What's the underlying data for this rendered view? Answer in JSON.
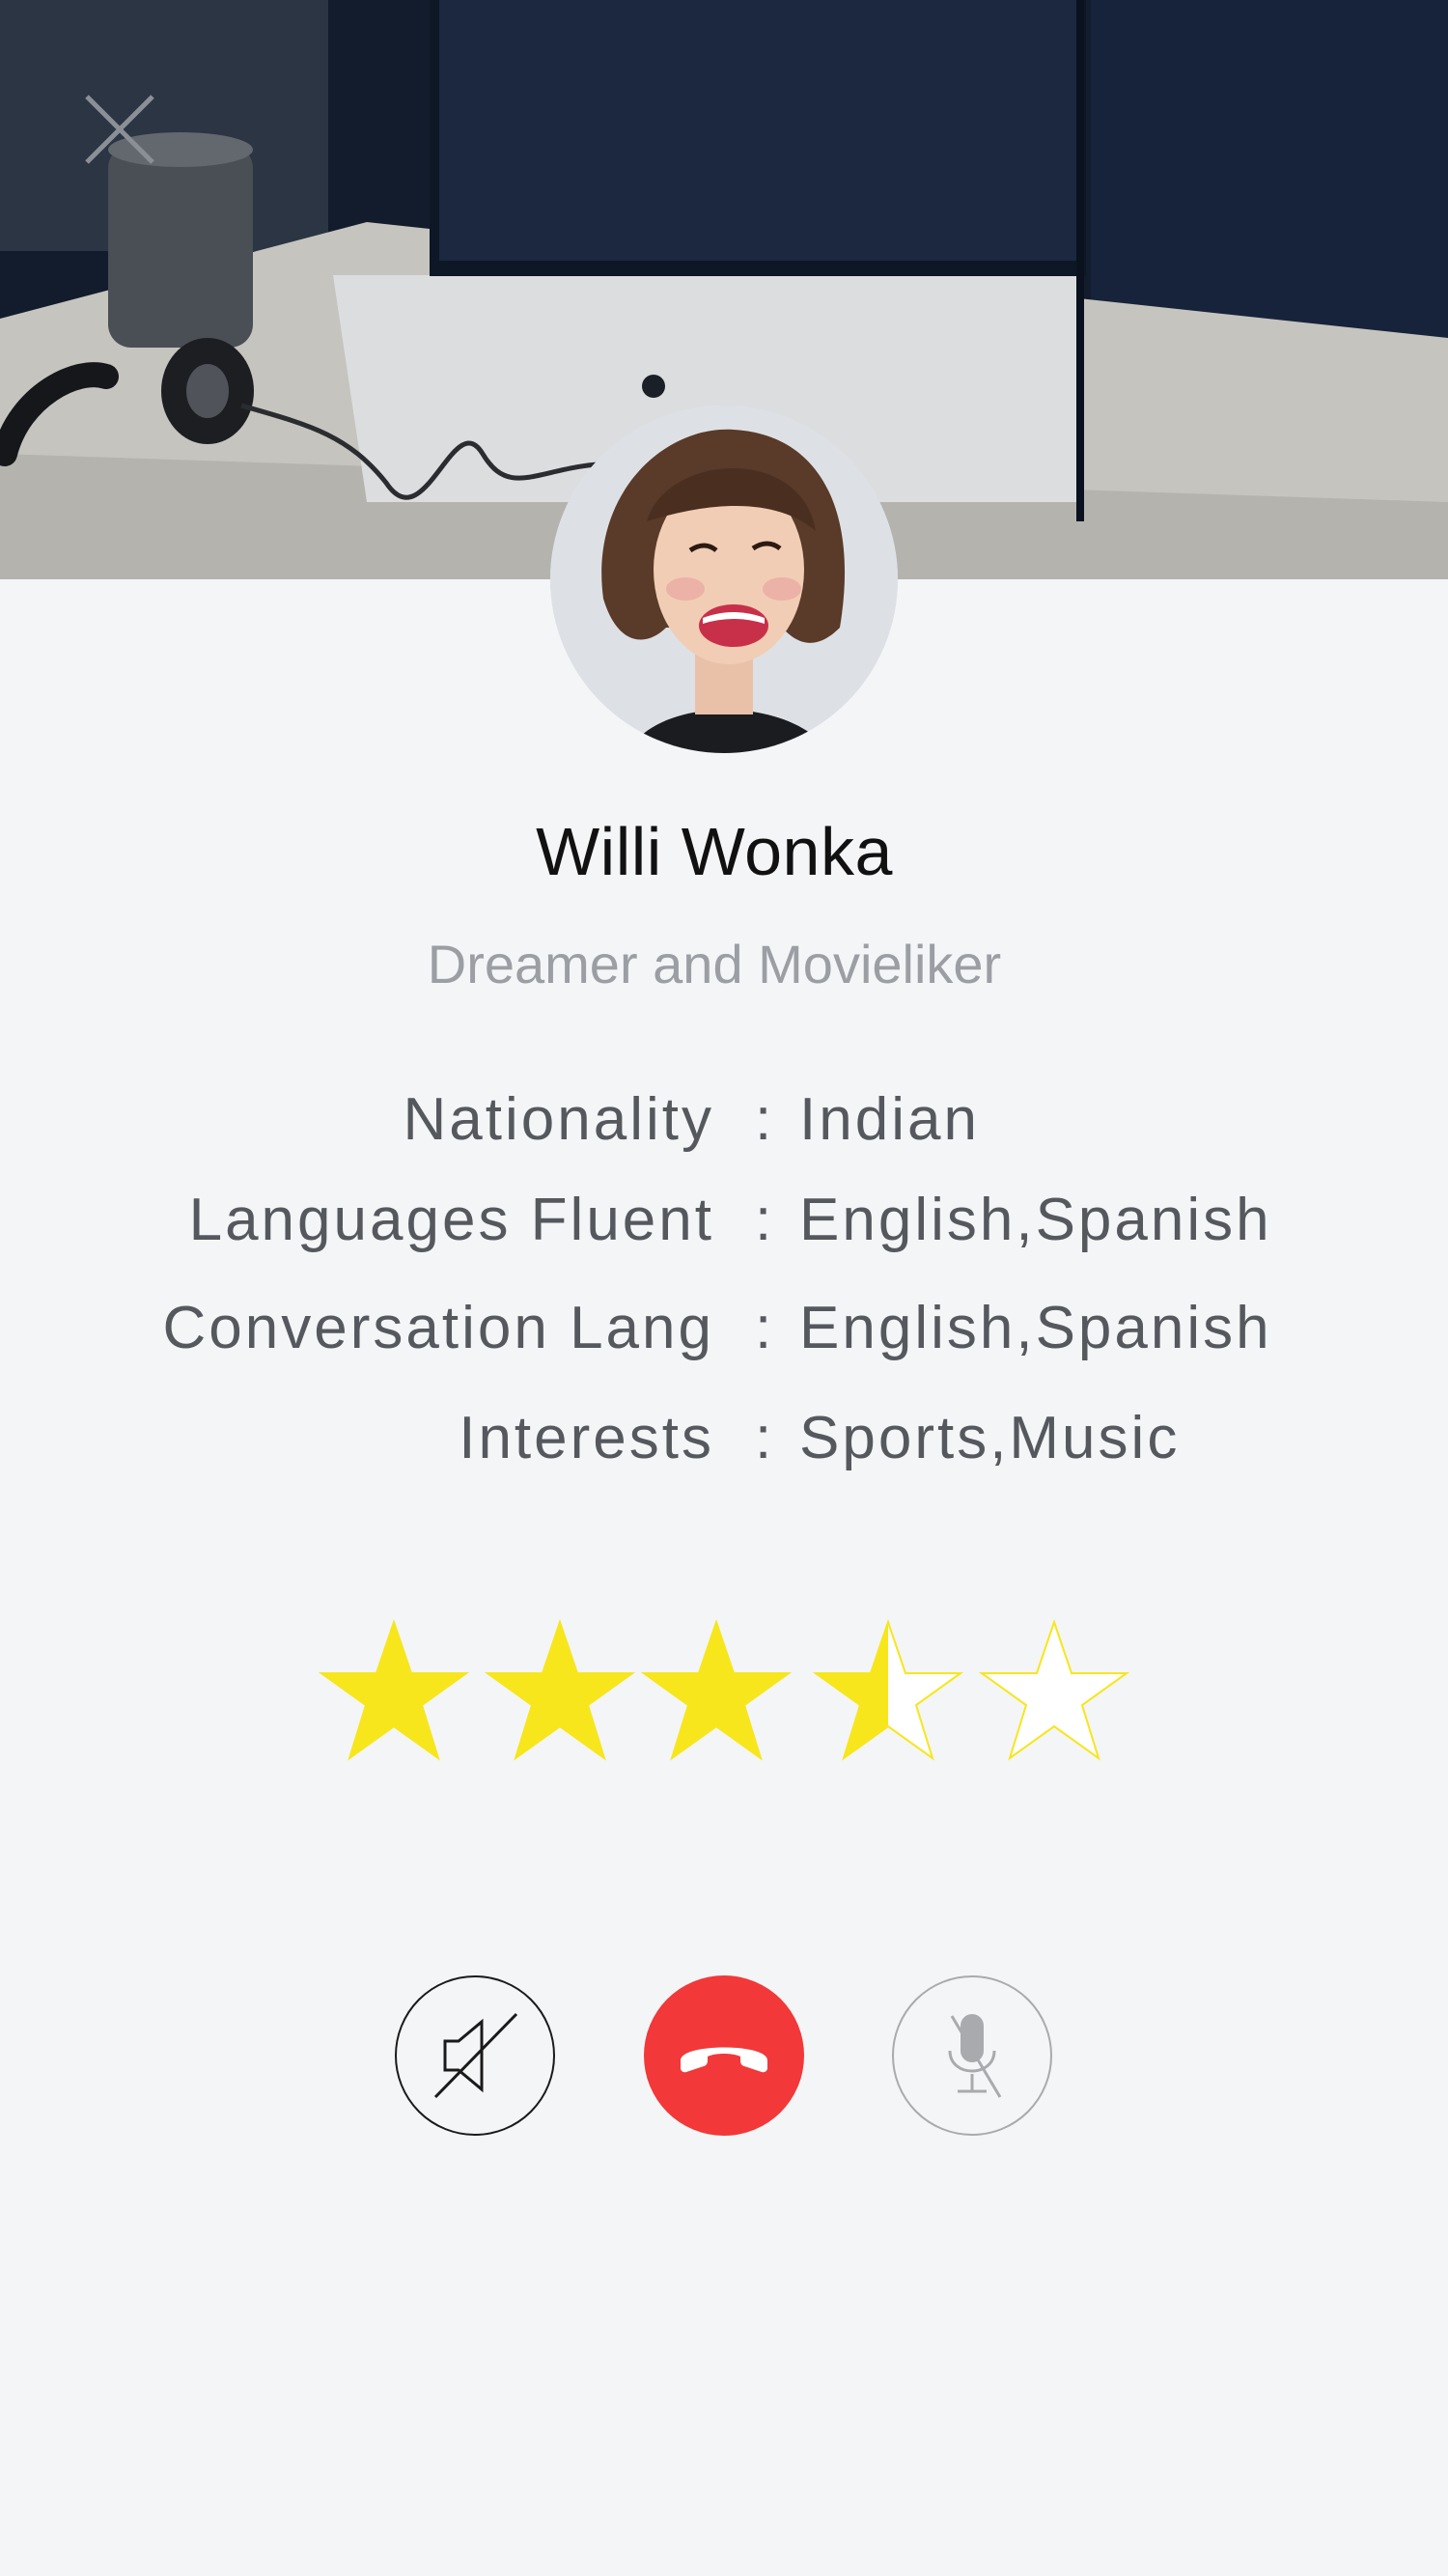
{
  "header": {
    "close_icon": "close-icon"
  },
  "profile": {
    "name": "Willi Wonka",
    "tagline": "Dreamer and Movieliker"
  },
  "details": [
    {
      "label": "Nationality",
      "colon": ":",
      "value": "Indian"
    },
    {
      "label": "Languages Fluent",
      "colon": ":",
      "value": "English,Spanish"
    },
    {
      "label": "Conversation Lang",
      "colon": ":",
      "value": "English,Spanish"
    },
    {
      "label": "Interests",
      "colon": ":",
      "value": "Sports,Music"
    }
  ],
  "rating": {
    "value": 3.5,
    "max": 5,
    "star_color": "#f7e61c"
  },
  "call_controls": {
    "speaker_icon": "speaker-muted-icon",
    "end_call_icon": "phone-hangup-icon",
    "mic_icon": "mic-muted-icon",
    "end_call_color": "#f23838"
  }
}
